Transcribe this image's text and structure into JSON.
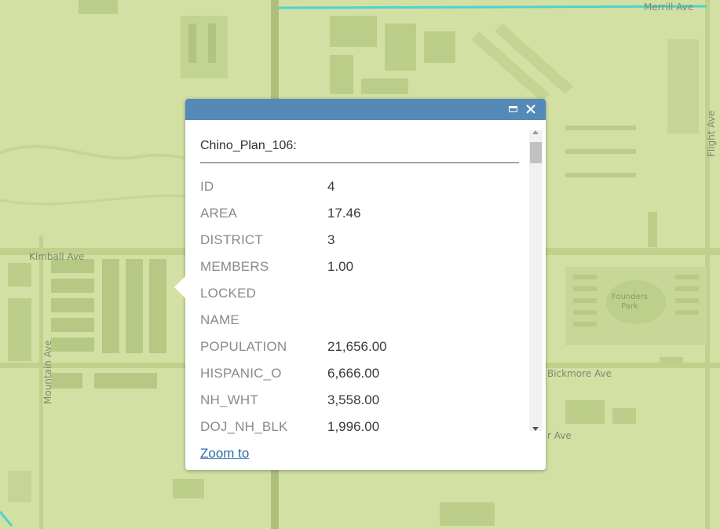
{
  "map": {
    "road_labels": {
      "merrill": "Merrill Ave",
      "flight": "Flight Ave",
      "kimball": "Kimball Ave",
      "mountain": "Mountain Ave",
      "bickmore": "Bickmore Ave",
      "partial_ave": "r Ave"
    },
    "park_label_line1": "Founders",
    "park_label_line2": "Park",
    "colors": {
      "background": "#d2e0a4",
      "road": "#bccf8a",
      "building": "#bfd08d",
      "boundary": "#4fd3d0"
    }
  },
  "popup": {
    "title": "Chino_Plan_106:",
    "header_color": "#5589b8",
    "maximize_icon": "maximize-icon",
    "close_icon": "close-icon",
    "attributes": [
      {
        "name": "ID",
        "value": "4"
      },
      {
        "name": "AREA",
        "value": "17.46"
      },
      {
        "name": "DISTRICT",
        "value": "3"
      },
      {
        "name": "MEMBERS",
        "value": "1.00"
      },
      {
        "name": "LOCKED",
        "value": ""
      },
      {
        "name": "NAME",
        "value": ""
      },
      {
        "name": "POPULATION",
        "value": "21,656.00"
      },
      {
        "name": "HISPANIC_O",
        "value": "6,666.00"
      },
      {
        "name": "NH_WHT",
        "value": "3,558.00"
      },
      {
        "name": "DOJ_NH_BLK",
        "value": "1,996.00"
      }
    ],
    "zoom_link": "Zoom to"
  }
}
